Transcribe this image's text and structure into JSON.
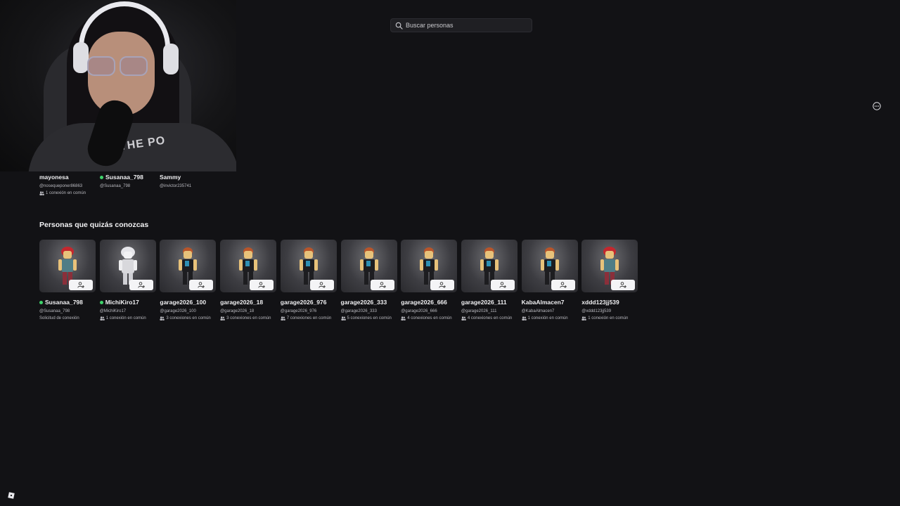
{
  "search": {
    "placeholder": "Buscar personas"
  },
  "connections": [
    {
      "name": "mayonesa",
      "handle": "@nosequeponer86863",
      "mutual": "1 conexión en común",
      "online": false
    },
    {
      "name": "Susanaa_798",
      "handle": "@Susanaa_798",
      "mutual": "",
      "online": true
    },
    {
      "name": "Sammy",
      "handle": "@invictor235741",
      "mutual": "",
      "online": false
    }
  ],
  "suggestions": {
    "title": "Personas que quizás conozcas",
    "items": [
      {
        "name": "Susanaa_798",
        "handle": "@Susanaa_798",
        "mutual": "Solicitud de conexión",
        "online": true,
        "avatar": "red-hair"
      },
      {
        "name": "MichiKiro17",
        "handle": "@MichiKiro17",
        "mutual": "1 conexión en común",
        "online": true,
        "avatar": "white"
      },
      {
        "name": "garage2026_100",
        "handle": "@garage2026_100",
        "mutual": "3 conexiones en común",
        "online": false,
        "avatar": "default"
      },
      {
        "name": "garage2026_18",
        "handle": "@garage2026_18",
        "mutual": "3 conexiones en común",
        "online": false,
        "avatar": "default"
      },
      {
        "name": "garage2026_976",
        "handle": "@garage2026_976",
        "mutual": "7 conexiones en común",
        "online": false,
        "avatar": "default"
      },
      {
        "name": "garage2026_333",
        "handle": "@garage2026_333",
        "mutual": "5 conexiones en común",
        "online": false,
        "avatar": "default"
      },
      {
        "name": "garage2026_666",
        "handle": "@garage2026_666",
        "mutual": "4 conexiones en común",
        "online": false,
        "avatar": "default"
      },
      {
        "name": "garage2026_111",
        "handle": "@garage2026_111",
        "mutual": "4 conexiones en común",
        "online": false,
        "avatar": "default"
      },
      {
        "name": "KabaAlmacen7",
        "handle": "@KabaAlmacen7",
        "mutual": "1 conexión en común",
        "online": false,
        "avatar": "default"
      },
      {
        "name": "xddd123jj539",
        "handle": "@xddd123jj539",
        "mutual": "1 conexión en común",
        "online": false,
        "avatar": "red-hair"
      }
    ]
  },
  "webcam": {
    "shirt_text": "THE PO"
  },
  "colors": {
    "background": "#121215",
    "online": "#3ed36a",
    "card": "#3d3d42",
    "button": "#f4f4f6"
  },
  "icons": {
    "search": "search-icon",
    "more": "more-options-icon",
    "people": "people-icon",
    "add_friend": "add-friend-icon",
    "logo": "roblox-logo-icon"
  }
}
